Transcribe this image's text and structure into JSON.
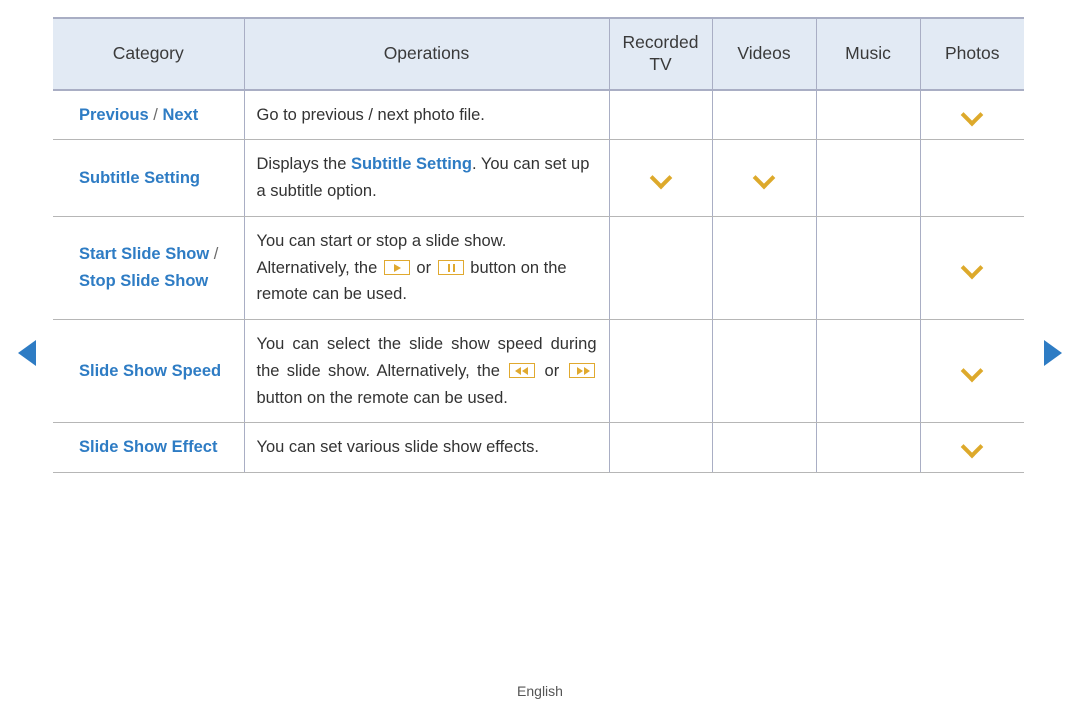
{
  "nav": {
    "prev_icon": "triangle-left-icon",
    "next_icon": "triangle-right-icon",
    "accent_color": "#2e7cc4"
  },
  "colors": {
    "link_blue": "#2e7cc4",
    "header_bg": "#e2eaf4",
    "header_border": "#a9aec4",
    "row_border": "#b6b6b6",
    "mark_amber": "#dda92b",
    "key_amber": "#e0a92f",
    "body_text": "#333333"
  },
  "table": {
    "headers": {
      "category": "Category",
      "operations": "Operations",
      "recorded_tv_line1": "Recorded",
      "recorded_tv_line2": "TV",
      "videos": "Videos",
      "music": "Music",
      "photos": "Photos"
    },
    "rows": [
      {
        "category_parts": [
          "Previous",
          " / ",
          "Next"
        ],
        "operations_text": "Go to previous / next photo file.",
        "recorded_tv": "",
        "videos": "",
        "music": "",
        "photos": "chevron-mark"
      },
      {
        "category_parts": [
          "Subtitle Setting"
        ],
        "operations_pre": "Displays the ",
        "operations_hl": "Subtitle Setting",
        "operations_post": ". You can set up a subtitle option.",
        "recorded_tv": "chevron-mark",
        "videos": "chevron-mark",
        "music": "",
        "photos": ""
      },
      {
        "category_parts": [
          "Start Slide Show",
          " / ",
          "Stop Slide Show"
        ],
        "operations_seg1": "You can start or stop a slide show. Alternatively, the ",
        "operations_key1": "play-button-icon",
        "operations_seg2": " or ",
        "operations_key2": "pause-button-icon",
        "operations_seg3": " button on the remote can be used.",
        "recorded_tv": "",
        "videos": "",
        "music": "",
        "photos": "chevron-mark"
      },
      {
        "category_parts": [
          "Slide Show Speed"
        ],
        "operations_seg1": "You can select the slide show speed during the slide show. Alternatively, the ",
        "operations_key1": "rewind-button-icon",
        "operations_seg2": " or ",
        "operations_key2": "fast-forward-button-icon",
        "operations_seg3": " button on the remote can be used.",
        "recorded_tv": "",
        "videos": "",
        "music": "",
        "photos": "chevron-mark"
      },
      {
        "category_parts": [
          "Slide Show Effect"
        ],
        "operations_text": "You can set various slide show effects.",
        "recorded_tv": "",
        "videos": "",
        "music": "",
        "photos": "chevron-mark"
      }
    ]
  },
  "footer": {
    "language": "English"
  }
}
